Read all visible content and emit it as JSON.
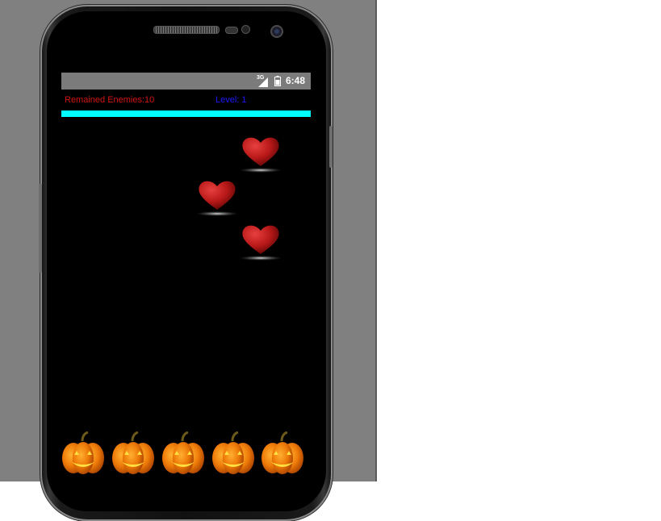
{
  "status_bar": {
    "network": "3G",
    "time": "6:48",
    "signal_icon": "signal-icon",
    "battery_icon": "battery-icon"
  },
  "hud": {
    "remained_enemies": "Remained Enemies:10",
    "level": "Level: 1",
    "progress_fraction": 1.0,
    "progress_color": "#00ffff"
  },
  "hearts": [
    {
      "icon": "heart-icon"
    },
    {
      "icon": "heart-icon"
    },
    {
      "icon": "heart-icon"
    }
  ],
  "pumpkins": [
    {
      "icon": "pumpkin-icon"
    },
    {
      "icon": "pumpkin-icon"
    },
    {
      "icon": "pumpkin-icon"
    },
    {
      "icon": "pumpkin-icon"
    },
    {
      "icon": "pumpkin-icon"
    }
  ],
  "colors": {
    "remained_text": "#d41414",
    "level_text": "#1a1aff",
    "heart": "#b81818"
  }
}
